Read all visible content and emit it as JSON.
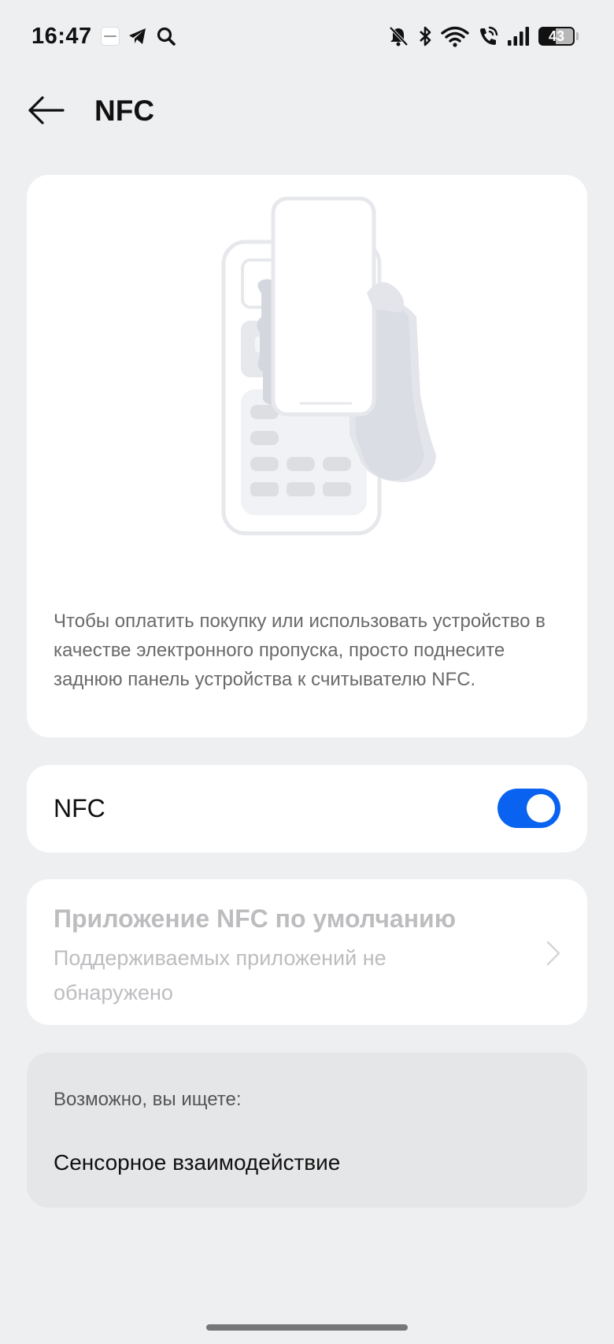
{
  "status_bar": {
    "time": "16:47",
    "battery": "43",
    "icons_left": [
      "realme-app-icon",
      "telegram-icon",
      "search-icon"
    ],
    "icons_right": [
      "bell-muted-icon",
      "bluetooth-icon",
      "wifi-icon",
      "wifi-call-icon",
      "signal-icon",
      "battery-icon"
    ]
  },
  "header": {
    "title": "NFC",
    "back_icon": "arrow-left-icon"
  },
  "illustration": {
    "description": "Чтобы оплатить покупку или использовать устройство в качестве электронного пропуска, просто поднесите заднюю панель устройства к считывателю NFC."
  },
  "nfc_toggle": {
    "label": "NFC",
    "state": true
  },
  "default_app": {
    "title": "Приложение NFC по умолчанию",
    "subtitle": "Поддерживаемых приложений не обнаружено"
  },
  "suggestions": {
    "heading": "Возможно, вы ищете:",
    "item": "Сенсорное взаимодействие"
  },
  "colors": {
    "background": "#EEEFF1",
    "accent": "#0A63F0",
    "disabled_text": "#BDBDC0"
  }
}
